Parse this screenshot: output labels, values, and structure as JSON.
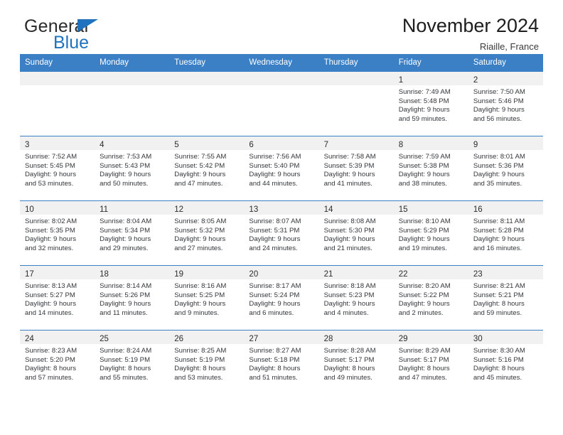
{
  "brand": {
    "name_part1": "General",
    "name_part2": "Blue",
    "flag_icon": "triangle-flag-icon",
    "accent_color": "#1f72bd"
  },
  "header": {
    "title": "November 2024",
    "subtitle": "Riaille, France"
  },
  "colors": {
    "header_row_bg": "#3b7fc4",
    "day_band_bg": "#f1f1f1",
    "text": "#33373a"
  },
  "calendar": {
    "day_headers": [
      "Sunday",
      "Monday",
      "Tuesday",
      "Wednesday",
      "Thursday",
      "Friday",
      "Saturday"
    ],
    "weeks": [
      [
        {
          "day": "",
          "empty": true
        },
        {
          "day": "",
          "empty": true
        },
        {
          "day": "",
          "empty": true
        },
        {
          "day": "",
          "empty": true
        },
        {
          "day": "",
          "empty": true
        },
        {
          "day": "1",
          "sunrise": "Sunrise: 7:49 AM",
          "sunset": "Sunset: 5:48 PM",
          "daylight1": "Daylight: 9 hours",
          "daylight2": "and 59 minutes."
        },
        {
          "day": "2",
          "sunrise": "Sunrise: 7:50 AM",
          "sunset": "Sunset: 5:46 PM",
          "daylight1": "Daylight: 9 hours",
          "daylight2": "and 56 minutes."
        }
      ],
      [
        {
          "day": "3",
          "sunrise": "Sunrise: 7:52 AM",
          "sunset": "Sunset: 5:45 PM",
          "daylight1": "Daylight: 9 hours",
          "daylight2": "and 53 minutes."
        },
        {
          "day": "4",
          "sunrise": "Sunrise: 7:53 AM",
          "sunset": "Sunset: 5:43 PM",
          "daylight1": "Daylight: 9 hours",
          "daylight2": "and 50 minutes."
        },
        {
          "day": "5",
          "sunrise": "Sunrise: 7:55 AM",
          "sunset": "Sunset: 5:42 PM",
          "daylight1": "Daylight: 9 hours",
          "daylight2": "and 47 minutes."
        },
        {
          "day": "6",
          "sunrise": "Sunrise: 7:56 AM",
          "sunset": "Sunset: 5:40 PM",
          "daylight1": "Daylight: 9 hours",
          "daylight2": "and 44 minutes."
        },
        {
          "day": "7",
          "sunrise": "Sunrise: 7:58 AM",
          "sunset": "Sunset: 5:39 PM",
          "daylight1": "Daylight: 9 hours",
          "daylight2": "and 41 minutes."
        },
        {
          "day": "8",
          "sunrise": "Sunrise: 7:59 AM",
          "sunset": "Sunset: 5:38 PM",
          "daylight1": "Daylight: 9 hours",
          "daylight2": "and 38 minutes."
        },
        {
          "day": "9",
          "sunrise": "Sunrise: 8:01 AM",
          "sunset": "Sunset: 5:36 PM",
          "daylight1": "Daylight: 9 hours",
          "daylight2": "and 35 minutes."
        }
      ],
      [
        {
          "day": "10",
          "sunrise": "Sunrise: 8:02 AM",
          "sunset": "Sunset: 5:35 PM",
          "daylight1": "Daylight: 9 hours",
          "daylight2": "and 32 minutes."
        },
        {
          "day": "11",
          "sunrise": "Sunrise: 8:04 AM",
          "sunset": "Sunset: 5:34 PM",
          "daylight1": "Daylight: 9 hours",
          "daylight2": "and 29 minutes."
        },
        {
          "day": "12",
          "sunrise": "Sunrise: 8:05 AM",
          "sunset": "Sunset: 5:32 PM",
          "daylight1": "Daylight: 9 hours",
          "daylight2": "and 27 minutes."
        },
        {
          "day": "13",
          "sunrise": "Sunrise: 8:07 AM",
          "sunset": "Sunset: 5:31 PM",
          "daylight1": "Daylight: 9 hours",
          "daylight2": "and 24 minutes."
        },
        {
          "day": "14",
          "sunrise": "Sunrise: 8:08 AM",
          "sunset": "Sunset: 5:30 PM",
          "daylight1": "Daylight: 9 hours",
          "daylight2": "and 21 minutes."
        },
        {
          "day": "15",
          "sunrise": "Sunrise: 8:10 AM",
          "sunset": "Sunset: 5:29 PM",
          "daylight1": "Daylight: 9 hours",
          "daylight2": "and 19 minutes."
        },
        {
          "day": "16",
          "sunrise": "Sunrise: 8:11 AM",
          "sunset": "Sunset: 5:28 PM",
          "daylight1": "Daylight: 9 hours",
          "daylight2": "and 16 minutes."
        }
      ],
      [
        {
          "day": "17",
          "sunrise": "Sunrise: 8:13 AM",
          "sunset": "Sunset: 5:27 PM",
          "daylight1": "Daylight: 9 hours",
          "daylight2": "and 14 minutes."
        },
        {
          "day": "18",
          "sunrise": "Sunrise: 8:14 AM",
          "sunset": "Sunset: 5:26 PM",
          "daylight1": "Daylight: 9 hours",
          "daylight2": "and 11 minutes."
        },
        {
          "day": "19",
          "sunrise": "Sunrise: 8:16 AM",
          "sunset": "Sunset: 5:25 PM",
          "daylight1": "Daylight: 9 hours",
          "daylight2": "and 9 minutes."
        },
        {
          "day": "20",
          "sunrise": "Sunrise: 8:17 AM",
          "sunset": "Sunset: 5:24 PM",
          "daylight1": "Daylight: 9 hours",
          "daylight2": "and 6 minutes."
        },
        {
          "day": "21",
          "sunrise": "Sunrise: 8:18 AM",
          "sunset": "Sunset: 5:23 PM",
          "daylight1": "Daylight: 9 hours",
          "daylight2": "and 4 minutes."
        },
        {
          "day": "22",
          "sunrise": "Sunrise: 8:20 AM",
          "sunset": "Sunset: 5:22 PM",
          "daylight1": "Daylight: 9 hours",
          "daylight2": "and 2 minutes."
        },
        {
          "day": "23",
          "sunrise": "Sunrise: 8:21 AM",
          "sunset": "Sunset: 5:21 PM",
          "daylight1": "Daylight: 8 hours",
          "daylight2": "and 59 minutes."
        }
      ],
      [
        {
          "day": "24",
          "sunrise": "Sunrise: 8:23 AM",
          "sunset": "Sunset: 5:20 PM",
          "daylight1": "Daylight: 8 hours",
          "daylight2": "and 57 minutes."
        },
        {
          "day": "25",
          "sunrise": "Sunrise: 8:24 AM",
          "sunset": "Sunset: 5:19 PM",
          "daylight1": "Daylight: 8 hours",
          "daylight2": "and 55 minutes."
        },
        {
          "day": "26",
          "sunrise": "Sunrise: 8:25 AM",
          "sunset": "Sunset: 5:19 PM",
          "daylight1": "Daylight: 8 hours",
          "daylight2": "and 53 minutes."
        },
        {
          "day": "27",
          "sunrise": "Sunrise: 8:27 AM",
          "sunset": "Sunset: 5:18 PM",
          "daylight1": "Daylight: 8 hours",
          "daylight2": "and 51 minutes."
        },
        {
          "day": "28",
          "sunrise": "Sunrise: 8:28 AM",
          "sunset": "Sunset: 5:17 PM",
          "daylight1": "Daylight: 8 hours",
          "daylight2": "and 49 minutes."
        },
        {
          "day": "29",
          "sunrise": "Sunrise: 8:29 AM",
          "sunset": "Sunset: 5:17 PM",
          "daylight1": "Daylight: 8 hours",
          "daylight2": "and 47 minutes."
        },
        {
          "day": "30",
          "sunrise": "Sunrise: 8:30 AM",
          "sunset": "Sunset: 5:16 PM",
          "daylight1": "Daylight: 8 hours",
          "daylight2": "and 45 minutes."
        }
      ]
    ]
  }
}
